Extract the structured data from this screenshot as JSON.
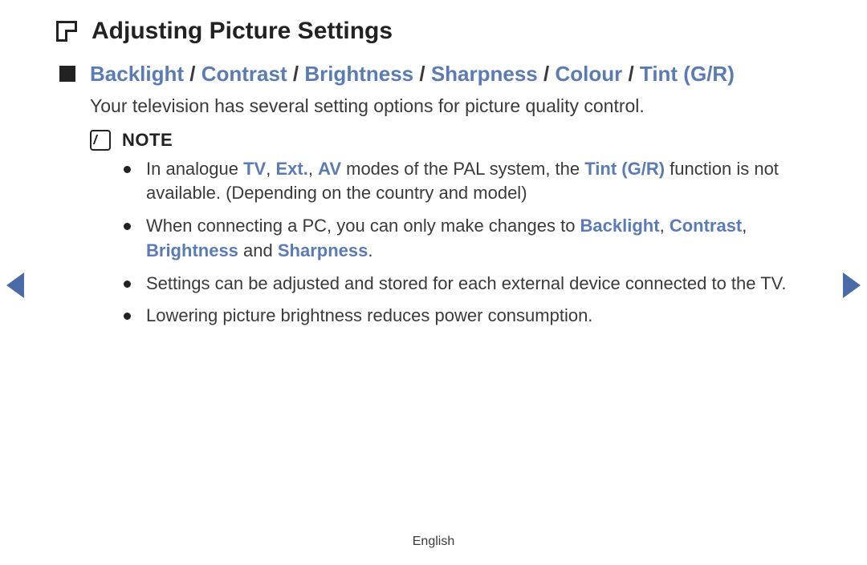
{
  "title": "Adjusting Picture Settings",
  "subtitle_terms": [
    "Backlight",
    "Contrast",
    "Brightness",
    "Sharpness",
    "Colour",
    "Tint (G/R)"
  ],
  "description": "Your television has several setting options for picture quality control.",
  "note_label": "NOTE",
  "notes": {
    "n1": {
      "pre": "In analogue ",
      "t1": "TV",
      "c1": ", ",
      "t2": "Ext.",
      "c2": ", ",
      "t3": "AV",
      "mid": " modes of the PAL system, the ",
      "t4": "Tint (G/R)",
      "post": " function is not available. (Depending on the country and model)"
    },
    "n2": {
      "pre": "When connecting a PC, you can only make changes to ",
      "t1": "Backlight",
      "c1": ", ",
      "t2": "Contrast",
      "c2": ", ",
      "t3": "Brightness",
      "mid": " and ",
      "t4": "Sharpness",
      "post": "."
    },
    "n3": "Settings can be adjusted and stored for each external device connected to the TV.",
    "n4": "Lowering picture brightness reduces power consumption."
  },
  "footer": "English"
}
